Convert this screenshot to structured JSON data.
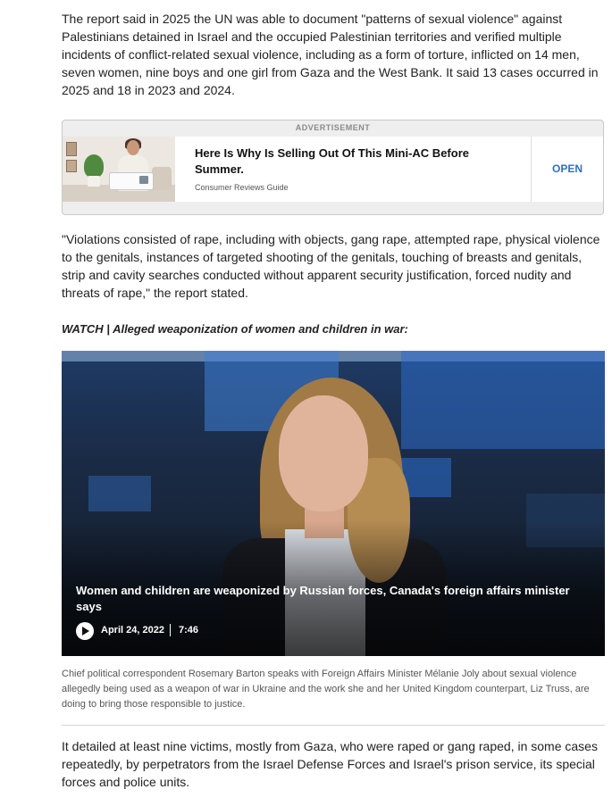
{
  "article": {
    "paragraph_1": "The report said in 2025 the UN was able to document \"patterns of sexual violence\" against Palestinians detained in Israel and the occupied Palestinian territories and verified multiple incidents of conflict-related sexual violence, including as a form of torture, inflicted on 14 men, seven women, nine boys and one girl from Gaza and the West Bank. It said 13 cases occurred in 2025 and 18 in 2023 and 2024.",
    "paragraph_2": "\"Violations consisted of rape, including with objects, gang rape, attempted rape, physical violence to the genitals, instances of targeted shooting of the genitals, touching of breasts and genitals, strip and cavity searches conducted without apparent security justification, forced nudity and threats of rape,\" the report stated.",
    "watch_label": "WATCH | Alleged weaponization of women and children in war:",
    "paragraph_3": "It detailed at least nine victims, mostly from Gaza, who were raped or gang raped, in some cases repeatedly, by perpetrators from the Israel Defense Forces and Israel's prison service, its special forces and police units."
  },
  "ad": {
    "label": "ADVERTISEMENT",
    "title": "Here Is Why Is Selling Out Of This Mini-AC Before Summer.",
    "source": "Consumer Reviews Guide",
    "cta": "OPEN"
  },
  "video": {
    "title": "Women and children are weaponized by Russian forces, Canada's foreign affairs minister says",
    "date": "April 24, 2022",
    "duration": "7:46",
    "caption": "Chief political correspondent Rosemary Barton speaks with Foreign Affairs Minister Mélanie Joly about sexual violence allegedly being used as a weapon of war in Ukraine and the work she and her United Kingdom counterpart, Liz Truss, are doing to bring those responsible to justice."
  },
  "colors": {
    "link_blue": "#2f6fc4",
    "text": "#222222",
    "caption_gray": "#555555"
  }
}
